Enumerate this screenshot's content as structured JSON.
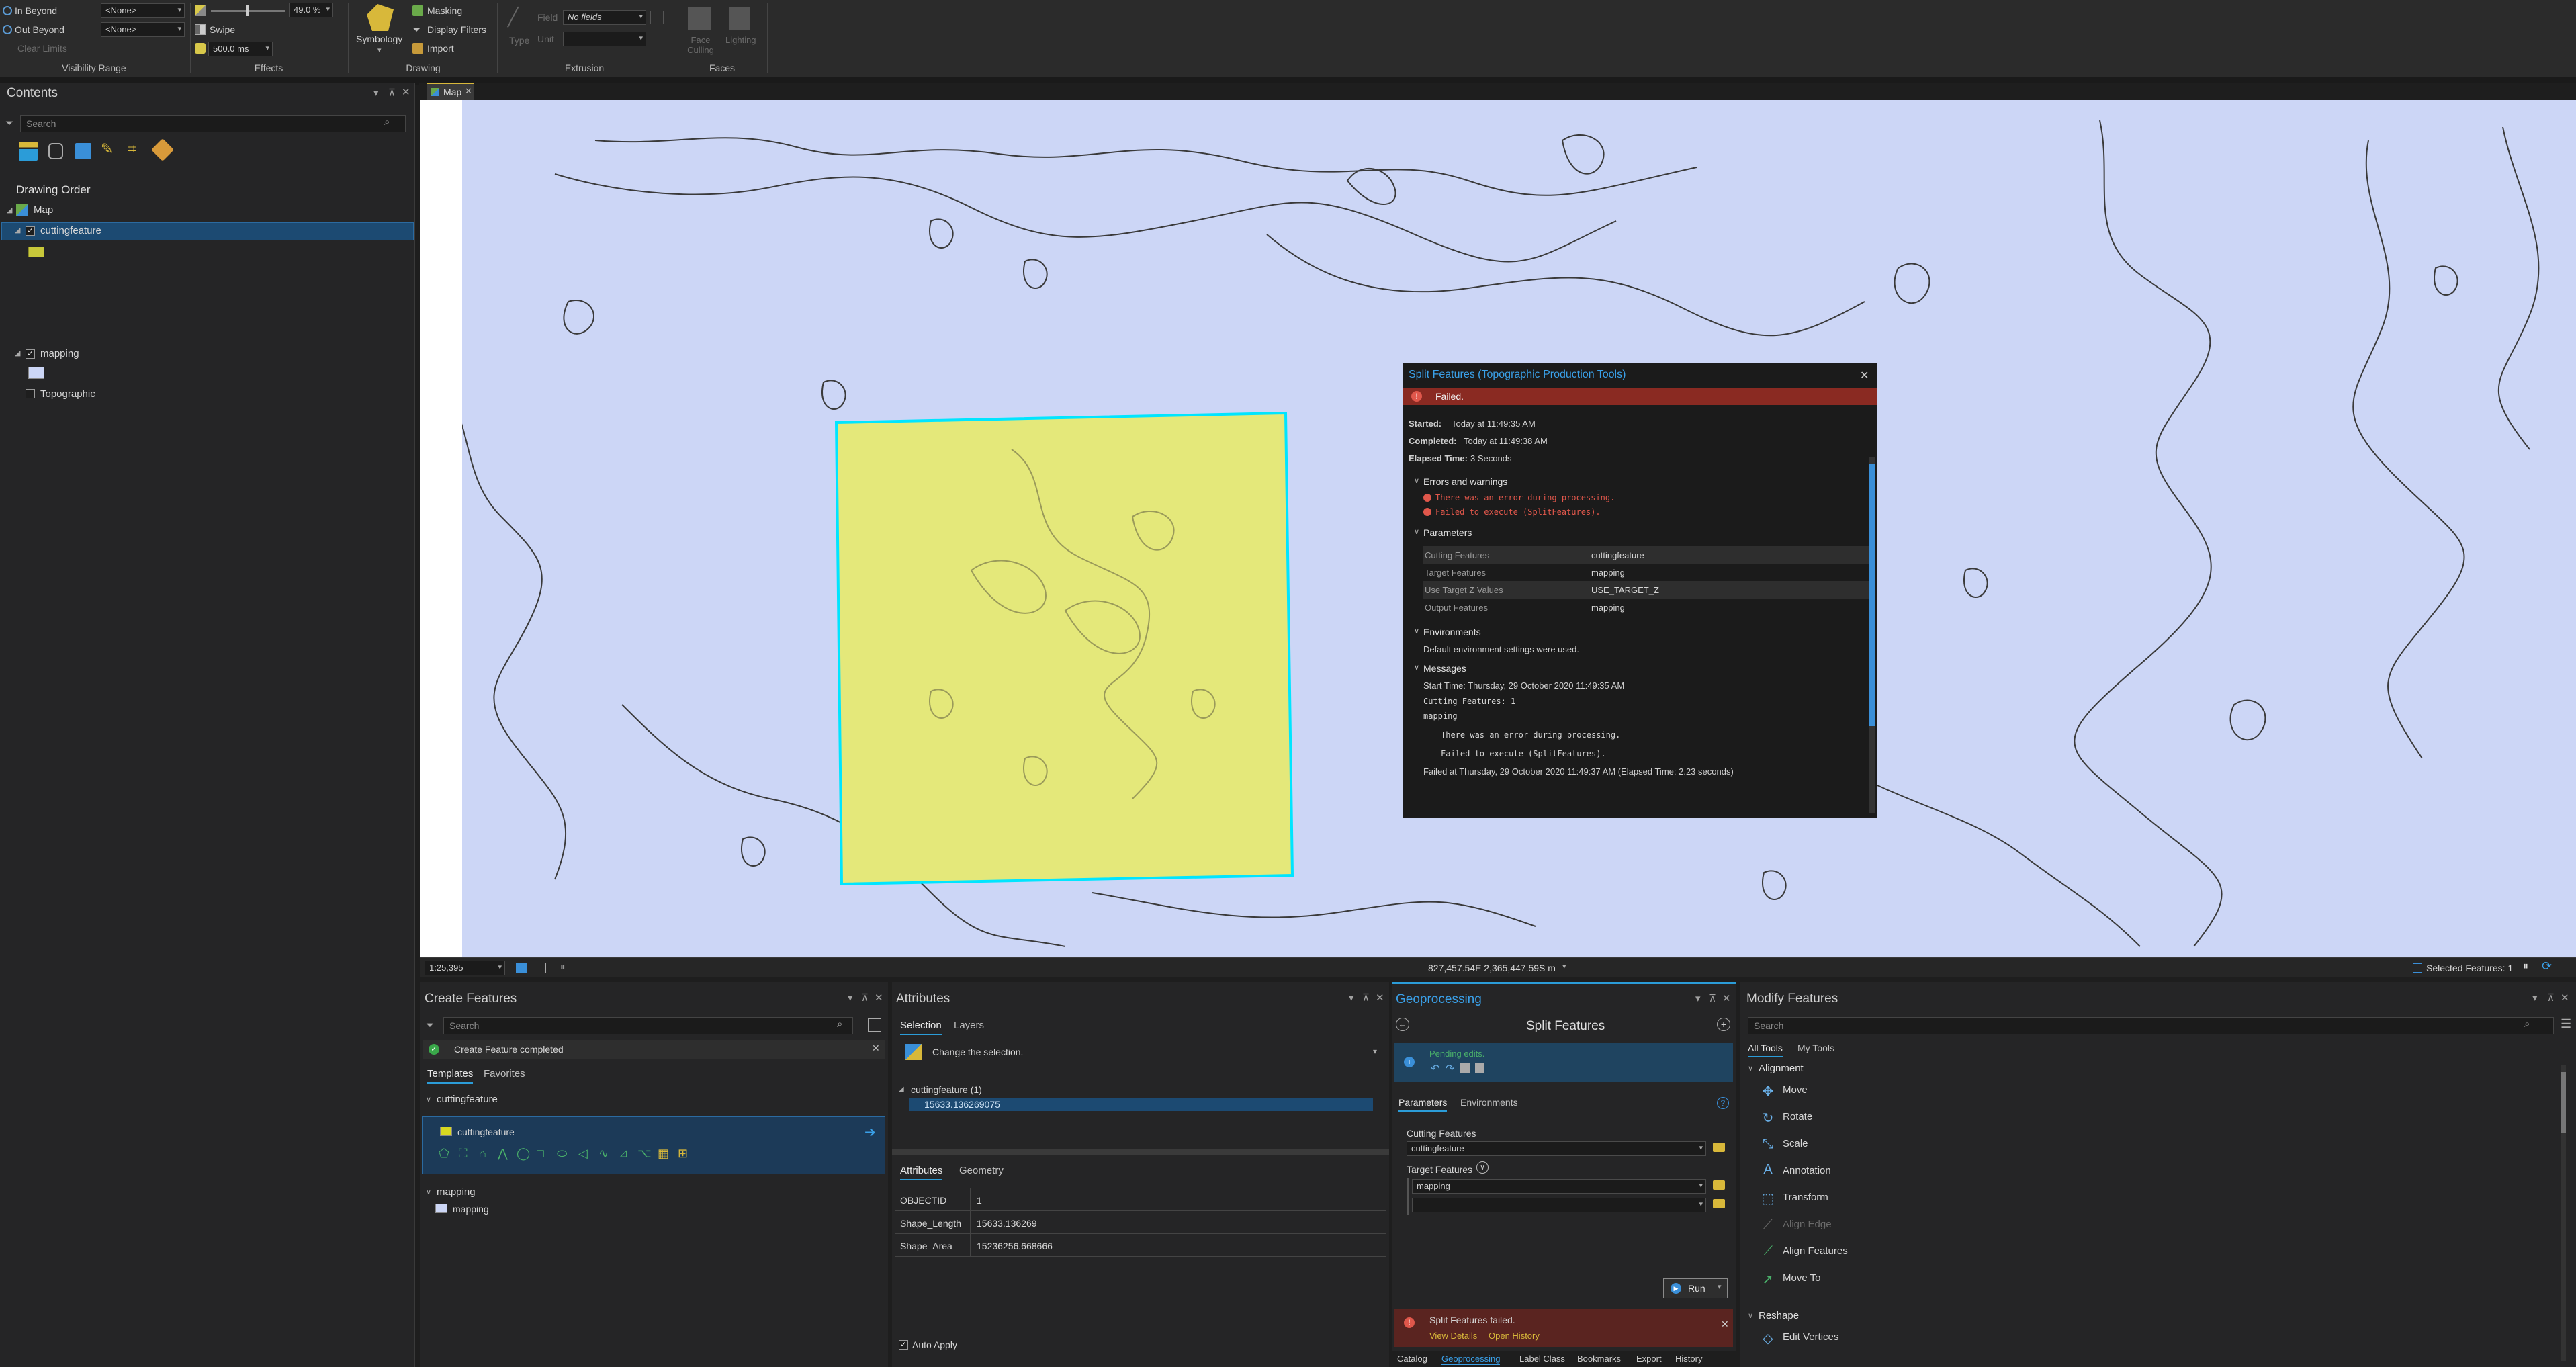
{
  "ribbon": {
    "in_beyond": "In Beyond",
    "out_beyond": "Out Beyond",
    "clear_limits": "Clear Limits",
    "none_1": "<None>",
    "none_2": "<None>",
    "visibility_range": "Visibility Range",
    "transparency": "49.0  %",
    "swipe": "Swipe",
    "ms_value": "500.0  ms",
    "effects": "Effects",
    "symbology": "Symbology",
    "masking": "Masking",
    "display_filters": "Display Filters",
    "import": "Import",
    "drawing": "Drawing",
    "type": "Type",
    "field": "Field",
    "no_fields": "No fields",
    "unit": "Unit",
    "extrusion": "Extrusion",
    "face_culling": "Face Culling",
    "lighting": "Lighting",
    "faces": "Faces"
  },
  "contents": {
    "title": "Contents",
    "search_placeholder": "Search",
    "drawing_order": "Drawing Order",
    "map": "Map",
    "layers": [
      {
        "name": "cuttingfeature",
        "checked": true,
        "selected": true,
        "swatch": "#c8c83a"
      },
      {
        "name": "mapping",
        "checked": true,
        "selected": false,
        "swatch": "#ccd6f6"
      },
      {
        "name": "Topographic",
        "checked": false,
        "selected": false
      }
    ]
  },
  "map": {
    "tab_label": "Map",
    "scale": "1:25,395",
    "coords": "827,457.54E 2,365,447.59S m",
    "selected_features": "Selected Features: 1",
    "background": "#ccd6f6",
    "polygon_fill": "#e4e87a",
    "polygon_outline": "#00e5ff"
  },
  "popup": {
    "title": "Split Features (Topographic Production Tools)",
    "status": "Failed.",
    "started_label": "Started:",
    "started": "Today at 11:49:35 AM",
    "completed_label": "Completed:",
    "completed": "Today at 11:49:38 AM",
    "elapsed_label": "Elapsed Time:",
    "elapsed": "3 Seconds",
    "errors_heading": "Errors and warnings",
    "errors": [
      "There was an error during processing.",
      "Failed to execute (SplitFeatures)."
    ],
    "parameters_heading": "Parameters",
    "parameters": [
      {
        "name": "Cutting Features",
        "value": "cuttingfeature"
      },
      {
        "name": "Target Features",
        "value": "mapping"
      },
      {
        "name": "Use Target Z Values",
        "value": "USE_TARGET_Z"
      },
      {
        "name": "Output Features",
        "value": "mapping"
      }
    ],
    "environments_heading": "Environments",
    "environments_text": "Default environment settings were used.",
    "messages_heading": "Messages",
    "messages": [
      "Start Time: Thursday, 29 October 2020 11:49:35 AM",
      "Cutting Features: 1",
      "mapping",
      "There was an error during processing.",
      "Failed to execute (SplitFeatures).",
      "Failed at Thursday, 29 October 2020 11:49:37 AM (Elapsed Time: 2.23 seconds)"
    ]
  },
  "create_features": {
    "title": "Create Features",
    "search_placeholder": "Search",
    "notice": "Create Feature completed",
    "tab_templates": "Templates",
    "tab_favorites": "Favorites",
    "group1": "cuttingfeature",
    "template1": "cuttingfeature",
    "group2": "mapping",
    "template2": "mapping"
  },
  "attributes": {
    "title": "Attributes",
    "tab_selection": "Selection",
    "tab_layers": "Layers",
    "change_selection": "Change the selection.",
    "layer_node": "cuttingfeature (1)",
    "feature_id": "15633.136269075",
    "tab_attributes": "Attributes",
    "tab_geometry": "Geometry",
    "rows": [
      {
        "field": "OBJECTID",
        "value": "1"
      },
      {
        "field": "Shape_Length",
        "value": "15633.136269"
      },
      {
        "field": "Shape_Area",
        "value": "15236256.668666"
      }
    ],
    "auto_apply": "Auto Apply"
  },
  "geoprocessing": {
    "title": "Geoprocessing",
    "tool_title": "Split Features",
    "pending_edits": "Pending edits.",
    "tab_parameters": "Parameters",
    "tab_environments": "Environments",
    "cutting_label": "Cutting Features",
    "cutting_value": "cuttingfeature",
    "target_label": "Target Features",
    "target_value": "mapping",
    "run": "Run",
    "failed_msg": "Split Features failed.",
    "view_details": "View Details",
    "open_history": "Open History",
    "bottom_tabs": [
      "Catalog",
      "Geoprocessing",
      "Label Class",
      "Bookmarks",
      "Export",
      "History"
    ]
  },
  "modify_features": {
    "title": "Modify Features",
    "search_placeholder": "Search",
    "tab_all_tools": "All Tools",
    "tab_my_tools": "My Tools",
    "alignment_heading": "Alignment",
    "alignment_tools": [
      {
        "name": "Move",
        "icon": "move-icon",
        "enabled": true
      },
      {
        "name": "Rotate",
        "icon": "rotate-icon",
        "enabled": true
      },
      {
        "name": "Scale",
        "icon": "scale-icon",
        "enabled": true
      },
      {
        "name": "Annotation",
        "icon": "annotation-icon",
        "enabled": true
      },
      {
        "name": "Transform",
        "icon": "transform-icon",
        "enabled": true
      },
      {
        "name": "Align Edge",
        "icon": "align-edge-icon",
        "enabled": false
      },
      {
        "name": "Align Features",
        "icon": "align-features-icon",
        "enabled": true
      },
      {
        "name": "Move To",
        "icon": "move-to-icon",
        "enabled": true
      }
    ],
    "reshape_heading": "Reshape",
    "reshape_tools": [
      {
        "name": "Edit Vertices",
        "icon": "edit-vertices-icon",
        "enabled": true
      }
    ]
  }
}
